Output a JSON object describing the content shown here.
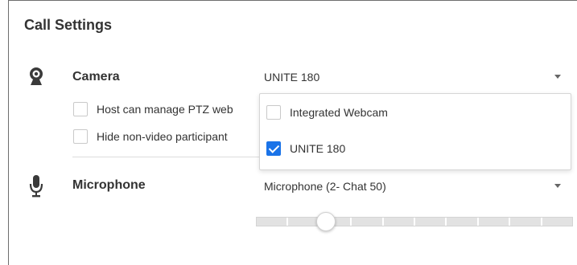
{
  "title": "Call Settings",
  "camera": {
    "label": "Camera",
    "icon": "webcam-icon",
    "selected": "UNITE 180",
    "options": [
      {
        "label": "Host can manage PTZ web",
        "checked": false
      },
      {
        "label": "Hide non-video participant",
        "checked": false
      }
    ],
    "dropdown": [
      {
        "label": "Integrated Webcam",
        "checked": false
      },
      {
        "label": "UNITE 180",
        "checked": true
      }
    ]
  },
  "microphone": {
    "label": "Microphone",
    "icon": "microphone-icon",
    "selected": "Microphone (2- Chat 50)",
    "level_fraction": 0.22
  },
  "colors": {
    "accent": "#1a73e8",
    "text": "#333333",
    "border": "#d6d6d6"
  }
}
